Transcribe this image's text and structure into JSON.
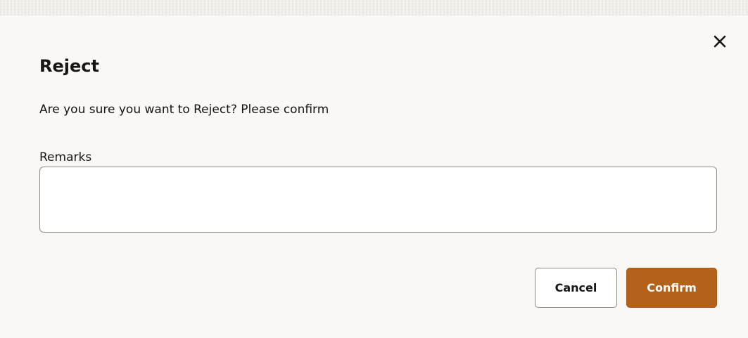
{
  "dialog": {
    "title": "Reject",
    "message": "Are you sure you want to Reject? Please confirm",
    "close_icon": "close-icon"
  },
  "remarks": {
    "label": "Remarks",
    "value": "",
    "placeholder": ""
  },
  "buttons": {
    "cancel_label": "Cancel",
    "confirm_label": "Confirm"
  },
  "colors": {
    "confirm_bg": "#b4621a",
    "text": "#161513",
    "border": "#8f8a84",
    "dialog_bg": "#f9f8f6"
  }
}
